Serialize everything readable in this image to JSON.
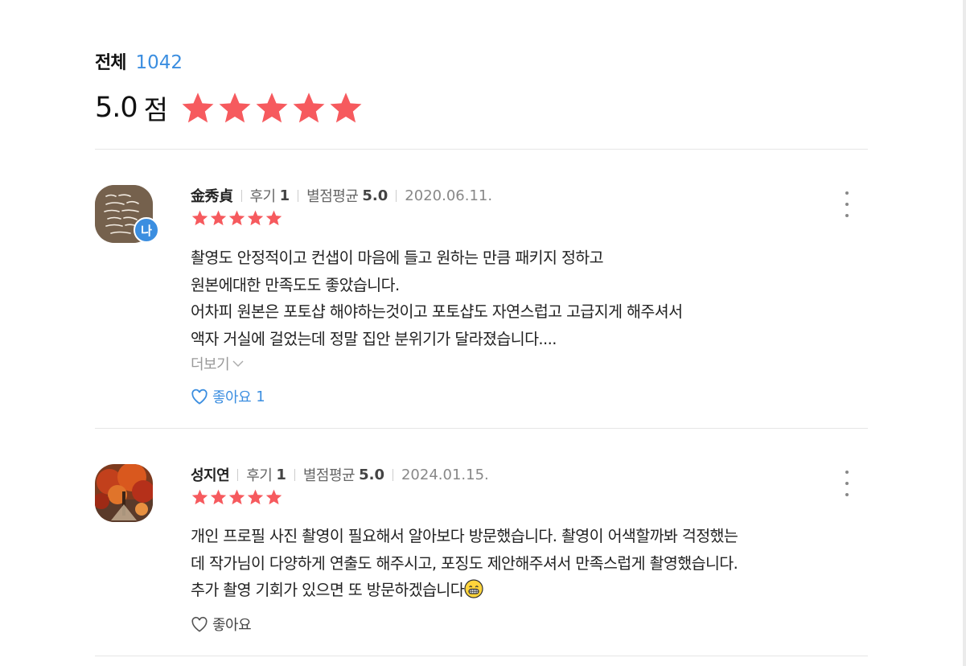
{
  "summary": {
    "label": "전체",
    "count": "1042",
    "score": "5.0",
    "score_unit": "점",
    "rating": 5
  },
  "reviews": [
    {
      "name": "金秀貞",
      "review_label": "후기",
      "review_count": "1",
      "avg_label": "별점평균",
      "avg_value": "5.0",
      "date": "2020.06.11.",
      "rating": 5,
      "is_me_badge": "나",
      "lines": [
        "촬영도 안정적이고 컨샙이 마음에 들고 원하는 만큼 패키지 정하고",
        "원본에대한 만족도도 좋았습니다.",
        "어차피 원본은 포토샵 해야하는것이고 포토샵도 자연스럽고 고급지게 해주셔서",
        "액자 거실에 걸었는데 정말 집안 분위기가 달라졌습니다...."
      ],
      "more_label": "더보기",
      "like_label": "좋아요",
      "like_count": "1"
    },
    {
      "name": "성지연",
      "review_label": "후기",
      "review_count": "1",
      "avg_label": "별점평균",
      "avg_value": "5.0",
      "date": "2024.01.15.",
      "rating": 5,
      "lines": [
        "개인 프로필 사진 촬영이 필요해서 알아보다 방문했습니다. 촬영이 어색할까봐 걱정했는",
        "데 작가님이 다양하게 연출도 해주시고, 포징도 제안해주셔서 만족스럽게 촬영했습니다.",
        "추가 촬영 기회가 있으면 또 방문하겠습니다"
      ],
      "like_label": "좋아요"
    }
  ],
  "colors": {
    "star": "#f65a5e",
    "accent": "#3b8ee0"
  },
  "icons": [
    "star-icon",
    "kebab-menu-icon",
    "chevron-down-icon",
    "heart-icon",
    "grinning-emoji-icon"
  ]
}
